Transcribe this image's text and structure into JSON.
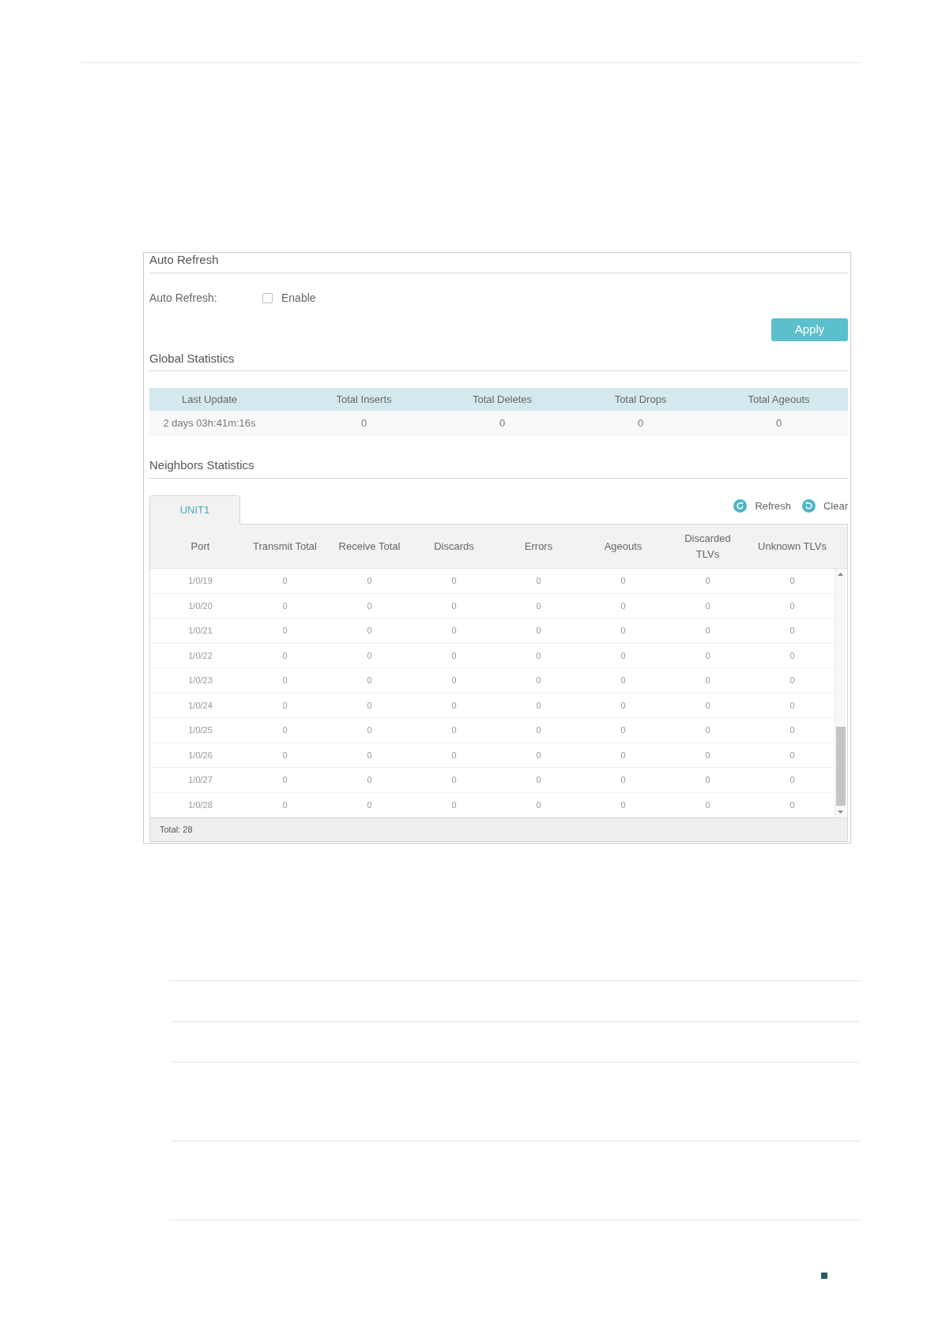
{
  "auto_refresh": {
    "title": "Auto Refresh",
    "label": "Auto Refresh:",
    "enable": {
      "label": "Enable",
      "checked": false
    },
    "apply_button": "Apply"
  },
  "global_statistics": {
    "title": "Global Statistics",
    "columns": [
      "Last Update",
      "Total Inserts",
      "Total Deletes",
      "Total Drops",
      "Total Ageouts"
    ],
    "rows": [
      [
        "2 days 03h:41m:16s",
        "0",
        "0",
        "0",
        "0"
      ]
    ]
  },
  "neighbors_statistics": {
    "title": "Neighbors Statistics",
    "tabs": [
      {
        "label": "UNIT1",
        "selected": true
      }
    ],
    "actions": [
      {
        "kind": "refresh",
        "label": "Refresh"
      },
      {
        "kind": "clear",
        "label": "Clear"
      }
    ],
    "table": {
      "columns": [
        "Port",
        "Transmit Total",
        "Receive Total",
        "Discards",
        "Errors",
        "Ageouts",
        "Discarded TLVs",
        "Unknown TLVs"
      ],
      "rows": [
        [
          "1/0/19",
          "0",
          "0",
          "0",
          "0",
          "0",
          "0",
          "0"
        ],
        [
          "1/0/20",
          "0",
          "0",
          "0",
          "0",
          "0",
          "0",
          "0"
        ],
        [
          "1/0/21",
          "0",
          "0",
          "0",
          "0",
          "0",
          "0",
          "0"
        ],
        [
          "1/0/22",
          "0",
          "0",
          "0",
          "0",
          "0",
          "0",
          "0"
        ],
        [
          "1/0/23",
          "0",
          "0",
          "0",
          "0",
          "0",
          "0",
          "0"
        ],
        [
          "1/0/24",
          "0",
          "0",
          "0",
          "0",
          "0",
          "0",
          "0"
        ],
        [
          "1/0/25",
          "0",
          "0",
          "0",
          "0",
          "0",
          "0",
          "0"
        ],
        [
          "1/0/26",
          "0",
          "0",
          "0",
          "0",
          "0",
          "0",
          "0"
        ],
        [
          "1/0/27",
          "0",
          "0",
          "0",
          "0",
          "0",
          "0",
          "0"
        ],
        [
          "1/0/28",
          "0",
          "0",
          "0",
          "0",
          "0",
          "0",
          "0"
        ]
      ]
    },
    "footer": "Total: 28"
  }
}
